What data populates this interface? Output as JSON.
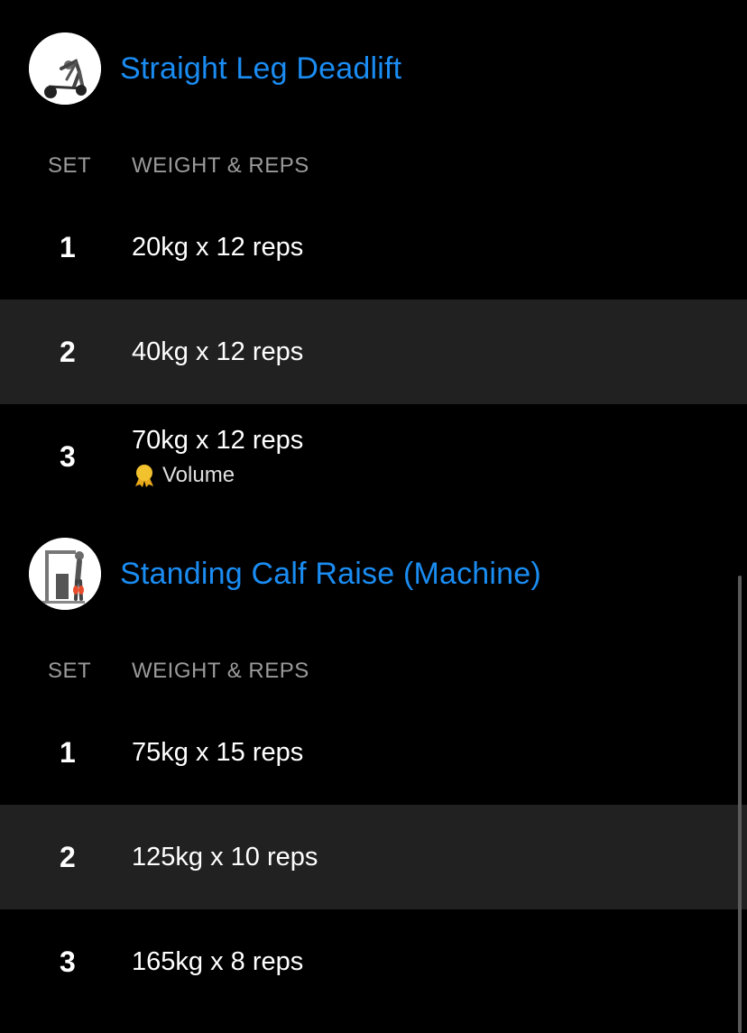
{
  "exercises": [
    {
      "title": "Straight Leg Deadlift",
      "thumbnail_icon": "deadlift-figure-icon",
      "header_set": "SET",
      "header_weight_reps": "WEIGHT & REPS",
      "sets": [
        {
          "number": "1",
          "value": "20kg x 12 reps"
        },
        {
          "number": "2",
          "value": "40kg x 12 reps"
        },
        {
          "number": "3",
          "value": "70kg x 12 reps",
          "record": "Volume",
          "record_icon": "medal-icon"
        }
      ]
    },
    {
      "title": "Standing Calf Raise (Machine)",
      "thumbnail_icon": "calf-raise-machine-icon",
      "header_set": "SET",
      "header_weight_reps": "WEIGHT & REPS",
      "sets": [
        {
          "number": "1",
          "value": "75kg x 15 reps"
        },
        {
          "number": "2",
          "value": "125kg x 10 reps"
        },
        {
          "number": "3",
          "value": "165kg x 8 reps"
        }
      ]
    }
  ],
  "colors": {
    "background": "#000000",
    "title_accent": "#1a8cf2",
    "alt_row": "#212121",
    "header_text": "#9a9a9a",
    "medal": "#f2c12e"
  }
}
